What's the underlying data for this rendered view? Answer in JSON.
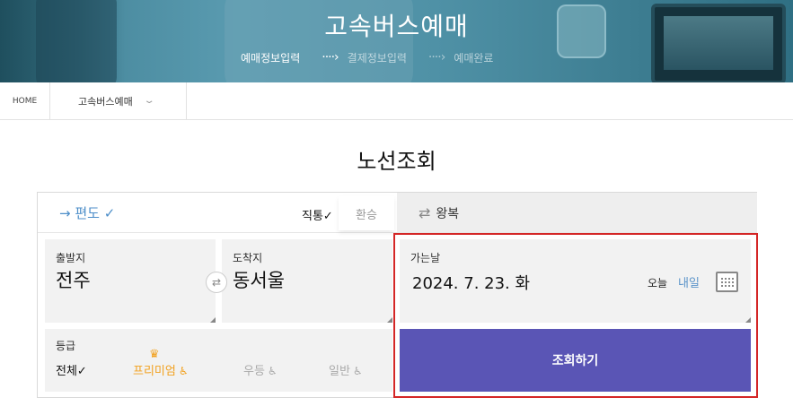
{
  "header": {
    "title": "고속버스예매",
    "steps": [
      {
        "label": "예매정보입력"
      },
      {
        "label": "결제정보입력"
      },
      {
        "label": "예매완료"
      }
    ],
    "arrow": "····›"
  },
  "breadcrumb": {
    "home": "HOME",
    "current": "고속버스예매",
    "chevron": "⌄"
  },
  "page_title": "노선조회",
  "trip_type": {
    "oneway": {
      "icon": "→",
      "label": "편도",
      "check": "✓"
    },
    "direct": "직통✓",
    "transfer": "환승",
    "roundtrip": {
      "icon": "⇄",
      "label": "왕복"
    }
  },
  "departure": {
    "label": "출발지",
    "value": "전주"
  },
  "arrival": {
    "label": "도착지",
    "value": "동서울"
  },
  "swap_icon": "⇄",
  "date": {
    "label": "가는날",
    "value": "2024. 7. 23. 화",
    "today": "오늘",
    "tomorrow": "내일"
  },
  "grade": {
    "label": "등급",
    "all": "전체✓",
    "premium": "프리미엄",
    "excellent": "우등",
    "general": "일반",
    "crown_icon": "♛",
    "seat_icon": "♿"
  },
  "search_button": "조회하기",
  "colors": {
    "accent_purple": "#5a55b5",
    "oneway_blue": "#4d8ec9",
    "premium_orange": "#f2a11f",
    "highlight_red": "#d42626"
  }
}
